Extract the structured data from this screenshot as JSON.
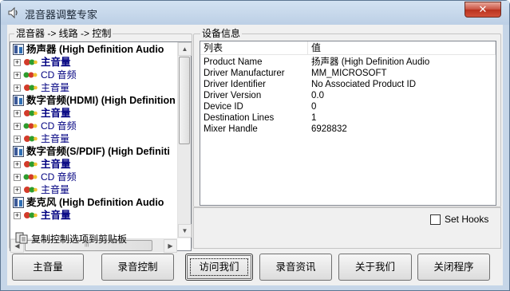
{
  "window": {
    "title": "混音器调整专家",
    "close_symbol": "✕"
  },
  "tree_panel": {
    "label": "混音器 -> 线路 -> 控制",
    "nodes": [
      {
        "kind": "device",
        "text": "扬声器 (High Definition Audio"
      },
      {
        "kind": "main",
        "text": "主音量"
      },
      {
        "kind": "cd",
        "text": "CD 音频"
      },
      {
        "kind": "minor",
        "text": "主音量"
      },
      {
        "kind": "device",
        "text": "数字音频(HDMI) (High Definition"
      },
      {
        "kind": "main",
        "text": "主音量"
      },
      {
        "kind": "cd",
        "text": "CD 音频"
      },
      {
        "kind": "minor",
        "text": "主音量"
      },
      {
        "kind": "device",
        "text": "数字音频(S/PDIF) (High Definiti"
      },
      {
        "kind": "main",
        "text": "主音量"
      },
      {
        "kind": "cd",
        "text": "CD 音频"
      },
      {
        "kind": "minor",
        "text": "主音量"
      },
      {
        "kind": "device",
        "text": "麦克风 (High Definition Audio"
      },
      {
        "kind": "main",
        "text": "主音量"
      }
    ],
    "copy_label": "复制控制选项到剪贴板"
  },
  "info_panel": {
    "label": "设备信息",
    "columns": [
      "列表",
      "值"
    ],
    "rows": [
      [
        "Product Name",
        "扬声器 (High Definition Audio"
      ],
      [
        "Driver Manufacturer",
        "MM_MICROSOFT"
      ],
      [
        "Driver Identifier",
        "No Associated Product ID"
      ],
      [
        "Driver Version",
        "0.0"
      ],
      [
        "Device ID",
        "0"
      ],
      [
        "Destination Lines",
        "1"
      ],
      [
        "Mixer Handle",
        "6928832"
      ]
    ]
  },
  "hooks": {
    "label": "Set Hooks",
    "checked": false
  },
  "buttons": [
    "主音量",
    "录音控制",
    "访问我们",
    "录音资讯",
    "关于我们",
    "关闭程序"
  ],
  "colors": {
    "accent": "#000080",
    "title_bg": "#c6d6e8",
    "close": "#c94a3a"
  }
}
